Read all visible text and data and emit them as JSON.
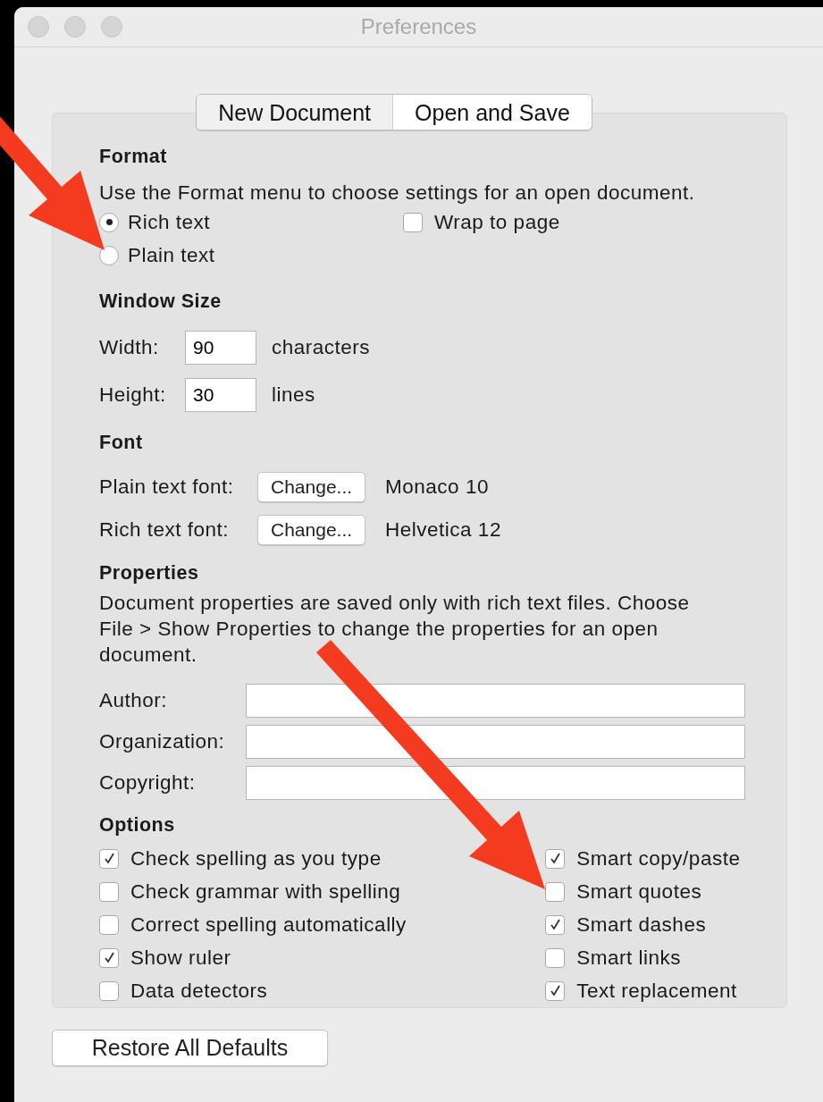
{
  "window": {
    "title": "Preferences"
  },
  "tabs": [
    {
      "label": "New Document",
      "selected": false
    },
    {
      "label": "Open and Save",
      "selected": true
    }
  ],
  "format": {
    "heading": "Format",
    "description": "Use the Format menu to choose settings for an open document.",
    "radios": [
      {
        "label": "Rich text",
        "selected": true
      },
      {
        "label": "Plain text",
        "selected": false
      }
    ],
    "wrap": {
      "label": "Wrap to page",
      "checked": false
    }
  },
  "window_size": {
    "heading": "Window Size",
    "fields": [
      {
        "label": "Width:",
        "value": "90",
        "unit": "characters"
      },
      {
        "label": "Height:",
        "value": "30",
        "unit": "lines"
      }
    ]
  },
  "font": {
    "heading": "Font",
    "rows": [
      {
        "label": "Plain text font:",
        "button": "Change...",
        "value": "Monaco 10"
      },
      {
        "label": "Rich text font:",
        "button": "Change...",
        "value": "Helvetica 12"
      }
    ]
  },
  "properties": {
    "heading": "Properties",
    "description": "Document properties are saved only with rich text files. Choose File > Show Properties to change the properties for an open document.",
    "fields": [
      {
        "label": "Author:"
      },
      {
        "label": "Organization:"
      },
      {
        "label": "Copyright:"
      }
    ]
  },
  "options": {
    "heading": "Options",
    "left": [
      {
        "label": "Check spelling as you type",
        "checked": true
      },
      {
        "label": "Check grammar with spelling",
        "checked": false
      },
      {
        "label": "Correct spelling automatically",
        "checked": false
      },
      {
        "label": "Show ruler",
        "checked": true
      },
      {
        "label": "Data detectors",
        "checked": false
      }
    ],
    "right": [
      {
        "label": "Smart copy/paste",
        "checked": true
      },
      {
        "label": "Smart quotes",
        "checked": false
      },
      {
        "label": "Smart dashes",
        "checked": true
      },
      {
        "label": "Smart links",
        "checked": false
      },
      {
        "label": "Text replacement",
        "checked": true
      }
    ]
  },
  "restore_button": "Restore All Defaults"
}
